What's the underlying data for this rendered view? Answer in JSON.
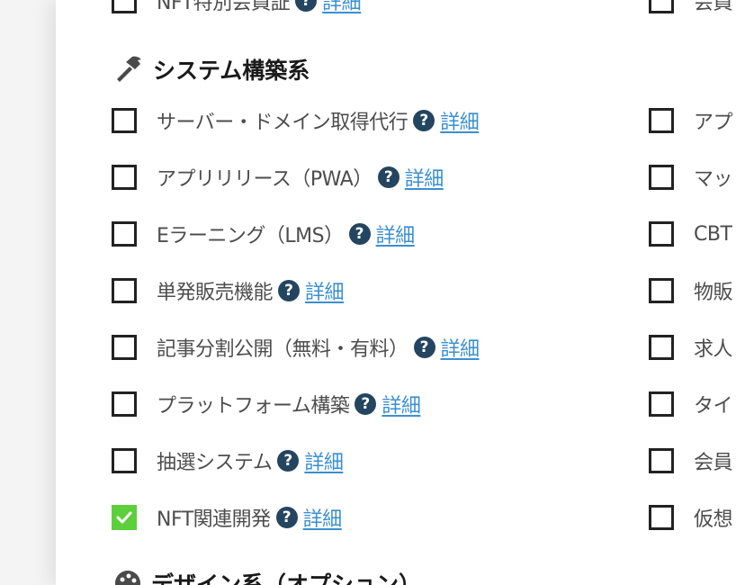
{
  "top_row": {
    "left": {
      "label": "NFT特別会員証",
      "detail": "詳細"
    },
    "right": {
      "label": "会員"
    }
  },
  "section_system": {
    "title": "システム構築系",
    "icon": "hammer-icon"
  },
  "left_items": [
    {
      "label": "サーバー・ドメイン取得代行",
      "detail": "詳細",
      "checked": false
    },
    {
      "label": "アプリリリース（PWA）",
      "detail": "詳細",
      "checked": false
    },
    {
      "label": "Eラーニング（LMS）",
      "detail": "詳細",
      "checked": false
    },
    {
      "label": "単発販売機能",
      "detail": "詳細",
      "checked": false
    },
    {
      "label": "記事分割公開（無料・有料）",
      "detail": "詳細",
      "checked": false
    },
    {
      "label": "プラットフォーム構築",
      "detail": "詳細",
      "checked": false
    },
    {
      "label": "抽選システム",
      "detail": "詳細",
      "checked": false
    },
    {
      "label": "NFT関連開発",
      "detail": "詳細",
      "checked": true
    }
  ],
  "right_items": [
    {
      "label": "アプ",
      "checked": false
    },
    {
      "label": "マッ",
      "checked": false
    },
    {
      "label": "CBT",
      "checked": false
    },
    {
      "label": "物販",
      "checked": false
    },
    {
      "label": "求人",
      "checked": false
    },
    {
      "label": "タイ",
      "checked": false
    },
    {
      "label": "会員",
      "checked": false
    },
    {
      "label": "仮想",
      "checked": false
    }
  ],
  "section_design": {
    "title": "デザイン系（オプション）",
    "icon": "palette-icon"
  },
  "colors": {
    "checkbox_checked": "#5ccf3c",
    "help_icon": "#24455f",
    "link": "#3a8fd0"
  }
}
